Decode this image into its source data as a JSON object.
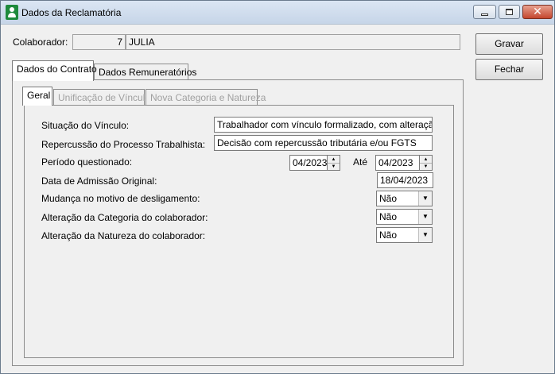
{
  "window": {
    "title": "Dados da Reclamatória"
  },
  "header": {
    "colaborador_label": "Colaborador:",
    "colaborador_code": "7",
    "colaborador_name": "JULIA"
  },
  "actions": {
    "save_label": "Gravar",
    "close_label": "Fechar"
  },
  "tabs": [
    {
      "label": "Dados do Contrato",
      "active": true
    },
    {
      "label": "Dados Remuneratórios",
      "active": false
    }
  ],
  "subtabs": [
    {
      "label": "Geral",
      "active": true,
      "enabled": true
    },
    {
      "label": "Unificação de Vínculo",
      "active": false,
      "enabled": false
    },
    {
      "label": "Nova Categoria e Natureza",
      "active": false,
      "enabled": false
    }
  ],
  "form": {
    "situacao_label": "Situação do Vínculo:",
    "situacao_value": "Trabalhador com vínculo formalizado, com alteração na d",
    "repercussao_label": "Repercussão do Processo Trabalhista:",
    "repercussao_value": "Decisão com repercussão tributária e/ou FGTS",
    "periodo_label": "Período questionado:",
    "periodo_start": "04/2023",
    "ate_label": "Até",
    "periodo_end": "04/2023",
    "admissao_label": "Data de Admissão Original:",
    "admissao_value": "18/04/2023",
    "mudanca_label": "Mudança no motivo de desligamento:",
    "mudanca_value": "Não",
    "alt_categoria_label": "Alteração da Categoria do colaborador:",
    "alt_categoria_value": "Não",
    "alt_natureza_label": "Alteração da Natureza do colaborador:",
    "alt_natureza_value": "Não"
  },
  "icons": {
    "app": "user-icon",
    "minimize": "minimize-icon",
    "maximize": "maximize-icon",
    "close": "close-icon",
    "spin_up": "triangle-up-icon",
    "spin_down": "triangle-down-icon",
    "dropdown": "chevron-down-icon"
  }
}
